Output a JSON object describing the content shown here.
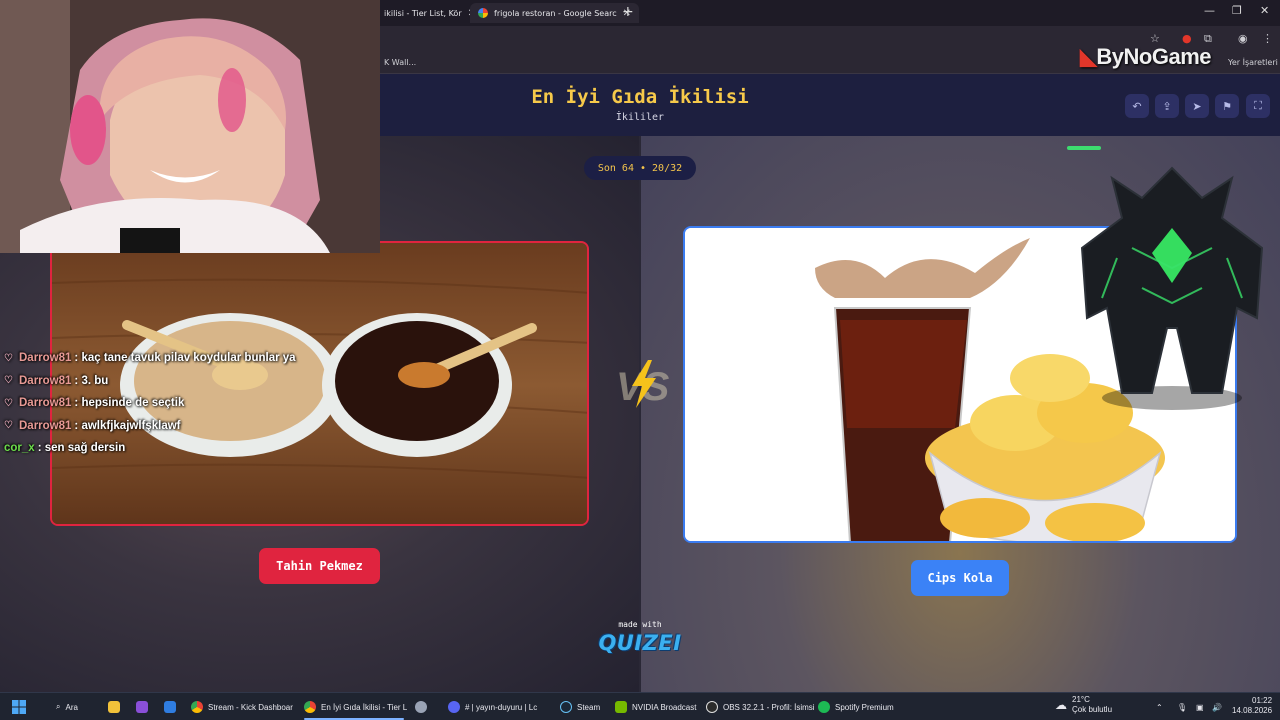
{
  "browser": {
    "tabs": [
      {
        "label": "ikilisi - Tier List, Kör"
      },
      {
        "label": "frigola restoran - Google Searc"
      }
    ],
    "bookmark_left": "K Wall...",
    "bookmark_right": "Yer İşaretleri"
  },
  "logo": {
    "text": "ByNoGame"
  },
  "quiz": {
    "title": "En İyi Gıda İkilisi",
    "subtitle": "İkililer",
    "progress": "Son 64 • 20/32",
    "left_choice": "Tahin Pekmez",
    "right_choice": "Cips Kola",
    "made_with": "made with",
    "brand": "QUIZEI"
  },
  "chat": [
    {
      "user": "Darrow81",
      "message": ": kaç tane tavuk pilav koydular bunlar ya"
    },
    {
      "user": "Darrow81",
      "message": ": 3. bu"
    },
    {
      "user": "Darrow81",
      "message": ": hepsinde de seçtik"
    },
    {
      "user": "Darrow81",
      "message": ": awlkfjkajwlfşklawf"
    },
    {
      "user": "cor_x",
      "message": ": sen sağ dersin"
    }
  ],
  "taskbar": {
    "search": "Ara",
    "items": [
      {
        "label": "Stream - Kick Dashboar"
      },
      {
        "label": "En İyi Gıda İkilisi - Tier L"
      },
      {
        "label": "# | yayın-duyuru | Lc"
      },
      {
        "label": "Steam"
      },
      {
        "label": "NVIDIA Broadcast"
      },
      {
        "label": "OBS 32.2.1 - Profil: İsimsi"
      },
      {
        "label": "Spotify Premium"
      }
    ],
    "weather_temp": "21°C",
    "weather_desc": "Çok bulutlu",
    "time": "01:22",
    "date": "14.08.2026"
  },
  "colors": {
    "accent_yellow": "#f6c94a",
    "left_red": "#e0243f",
    "right_blue": "#3b82f6",
    "header_navy": "#1d1f3f"
  }
}
